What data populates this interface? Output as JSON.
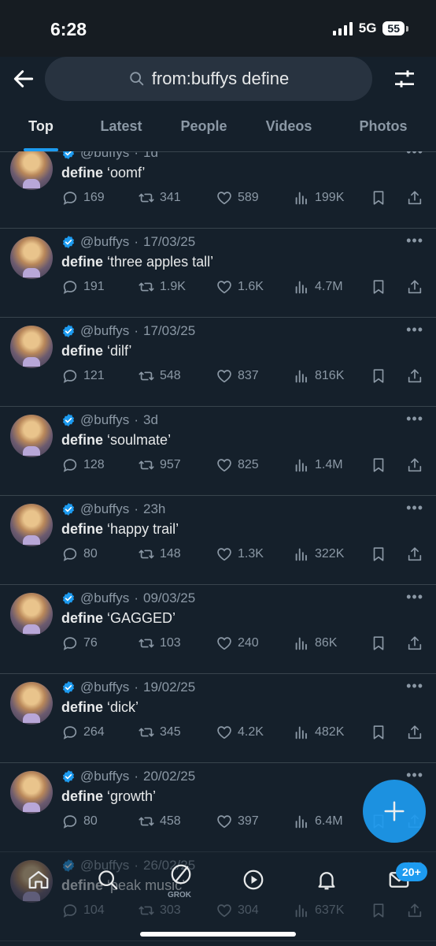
{
  "status_bar": {
    "time": "6:28",
    "network": "5G",
    "battery": "55"
  },
  "search": {
    "query": "from:buffys define"
  },
  "tabs": [
    {
      "label": "Top",
      "active": true
    },
    {
      "label": "Latest",
      "active": false
    },
    {
      "label": "People",
      "active": false
    },
    {
      "label": "Videos",
      "active": false
    },
    {
      "label": "Photos",
      "active": false
    }
  ],
  "tweets": [
    {
      "handle": "@buffys",
      "date": "1d",
      "keyword": "define",
      "text": "‘oomf’",
      "replies": "169",
      "retweets": "341",
      "likes": "589",
      "views": "199K"
    },
    {
      "handle": "@buffys",
      "date": "17/03/25",
      "keyword": "define",
      "text": "‘three apples tall’",
      "replies": "191",
      "retweets": "1.9K",
      "likes": "1.6K",
      "views": "4.7M"
    },
    {
      "handle": "@buffys",
      "date": "17/03/25",
      "keyword": "define",
      "text": "‘dilf’",
      "replies": "121",
      "retweets": "548",
      "likes": "837",
      "views": "816K"
    },
    {
      "handle": "@buffys",
      "date": "3d",
      "keyword": "define",
      "text": "‘soulmate’",
      "replies": "128",
      "retweets": "957",
      "likes": "825",
      "views": "1.4M"
    },
    {
      "handle": "@buffys",
      "date": "23h",
      "keyword": "define",
      "text": "‘happy trail’",
      "replies": "80",
      "retweets": "148",
      "likes": "1.3K",
      "views": "322K"
    },
    {
      "handle": "@buffys",
      "date": "09/03/25",
      "keyword": "define",
      "text": "‘GAGGED’",
      "replies": "76",
      "retweets": "103",
      "likes": "240",
      "views": "86K"
    },
    {
      "handle": "@buffys",
      "date": "19/02/25",
      "keyword": "define",
      "text": "‘dick’",
      "replies": "264",
      "retweets": "345",
      "likes": "4.2K",
      "views": "482K"
    },
    {
      "handle": "@buffys",
      "date": "20/02/25",
      "keyword": "define",
      "text": "‘growth’",
      "replies": "80",
      "retweets": "458",
      "likes": "397",
      "views": "6.4M"
    },
    {
      "handle": "@buffys",
      "date": "26/02/25",
      "keyword": "define",
      "text": "‘peak music’",
      "replies": "104",
      "retweets": "303",
      "likes": "304",
      "views": "637K"
    }
  ],
  "bottom_nav": {
    "grok_label": "GROK",
    "messages_badge": "20+"
  },
  "colors": {
    "background": "#15202b",
    "accent": "#1d9bf0",
    "muted": "#8b98a5",
    "text": "#e7e9ea"
  }
}
